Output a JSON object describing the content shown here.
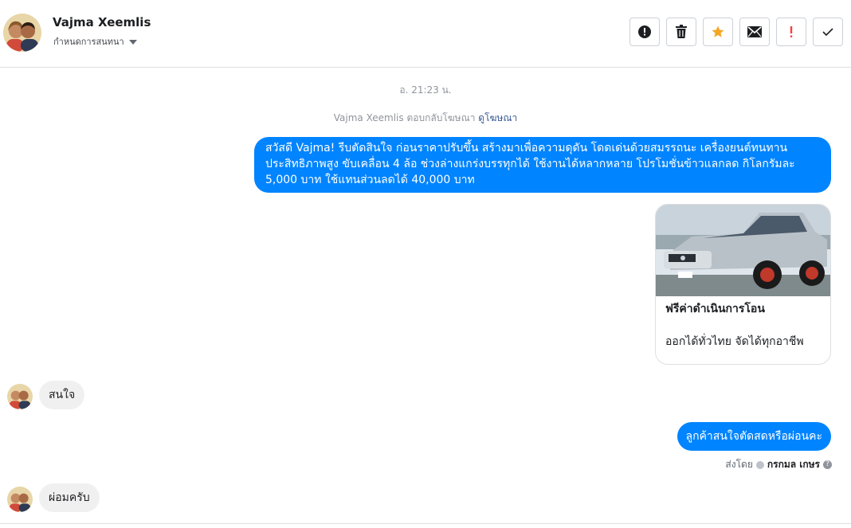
{
  "header": {
    "name": "Vajma Xeemlis",
    "subtitle": "กำหนดการสนทนา",
    "actions": [
      {
        "icon": "alert-circle-icon"
      },
      {
        "icon": "trash-icon"
      },
      {
        "icon": "star-icon",
        "color": "#f5a623"
      },
      {
        "icon": "envelope-icon"
      },
      {
        "icon": "exclamation-icon",
        "color": "#fa3e3e"
      },
      {
        "icon": "checkmark-icon"
      }
    ]
  },
  "conversation": {
    "timestamp": "อ. 21:23 น.",
    "ad_note": "Vajma Xeemlis ตอบกลับโฆษณา",
    "ad_link": "ดูโฆษณา",
    "messages": {
      "promo": "สวัสดี Vajma! รีบตัดสินใจ ก่อนราคาปรับขึ้น สร้างมาเพื่อความดุดัน โดดเด่นด้วยสมรรถนะ เครื่องยนต์ทนทาน ประสิทธิภาพสูง ขับเคลื่อน 4 ล้อ ช่วงล่างแกร่งบรรทุกได้ ใช้งานได้หลากหลาย โปรโมชั่นข้าวแลกลด กิโลกรัมละ 5,000 บาท ใช้แทนส่วนลดได้ 40,000 บาท",
      "reply_interested": "สนใจ",
      "agent_question": "ลูกค้าสนใจตัดสดหรือผ่อนคะ",
      "reply_installment": "ผ่อมครับ"
    },
    "card": {
      "title": "ฟรีค่าดำเนินการโอน",
      "subtitle": "ออกได้ทั่วไทย จัดได้ทุกอาชีพ"
    },
    "sent_by": {
      "label": "ส่งโดย",
      "name": "กรกมล เกษร"
    },
    "accent_color": "#0084ff"
  }
}
